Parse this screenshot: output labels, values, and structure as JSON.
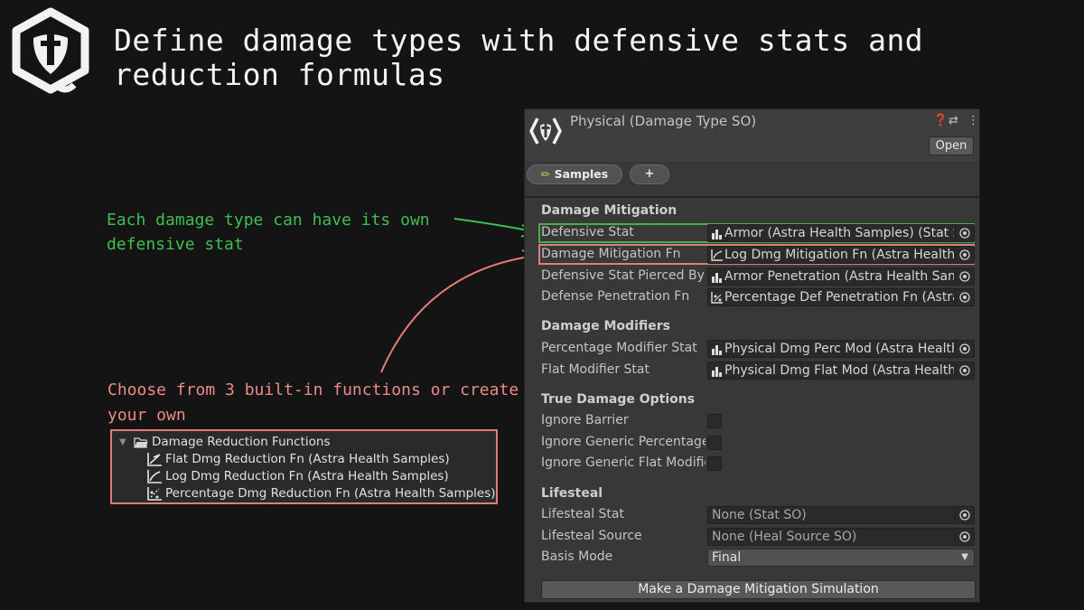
{
  "headline": "Define damage types with defensive stats and reduction formulas",
  "annotations": {
    "green": "Each damage type can have its own defensive stat",
    "red": "Choose from 3 built-in functions or create your own"
  },
  "tree": {
    "folder": "Damage Reduction Functions",
    "items": [
      "Flat Dmg Reduction Fn (Astra Health Samples)",
      "Log Dmg Reduction Fn (Astra Health Samples)",
      "Percentage Dmg Reduction  Fn (Astra Health Samples)"
    ]
  },
  "inspector": {
    "title": "Physical (Damage Type SO)",
    "open_label": "Open",
    "tab_samples": "Samples",
    "tab_add": "+",
    "sections": {
      "mitigation": "Damage Mitigation",
      "modifiers": "Damage Modifiers",
      "true_damage": "True Damage Options",
      "lifesteal": "Lifesteal"
    },
    "fields": {
      "defensive_stat": {
        "label": "Defensive Stat",
        "value": "Armor (Astra Health Samples) (Stat SO)"
      },
      "mitigation_fn": {
        "label": "Damage Mitigation Fn",
        "value": "Log Dmg Mitigation Fn (Astra Health Samples)"
      },
      "pierced_by": {
        "label": "Defensive Stat Pierced By",
        "value": "Armor Penetration (Astra Health Samples)"
      },
      "penetration_fn": {
        "label": "Defense Penetration Fn",
        "value": "Percentage Def Penetration Fn (Astra Health Samples)"
      },
      "perc_modifier": {
        "label": "Percentage Modifier Stat",
        "value": "Physical Dmg Perc Mod (Astra Health Samples)"
      },
      "flat_modifier": {
        "label": "Flat Modifier Stat",
        "value": "Physical Dmg Flat Mod (Astra Health Samples)"
      },
      "ignore_barrier": {
        "label": "Ignore Barrier"
      },
      "ignore_generic_perc": {
        "label": "Ignore Generic Percentage"
      },
      "ignore_generic_flat": {
        "label": "Ignore Generic Flat Modifier"
      },
      "lifesteal_stat": {
        "label": "Lifesteal Stat",
        "value": "None (Stat SO)"
      },
      "lifesteal_source": {
        "label": "Lifesteal Source",
        "value": "None (Heal Source SO)"
      },
      "basis_mode": {
        "label": "Basis Mode",
        "value": "Final"
      }
    },
    "simulate_label": "Make a Damage Mitigation Simulation"
  },
  "colors": {
    "green_accent": "#3fbf52",
    "red_accent": "#ec8b87",
    "background": "#141414",
    "inspector_bg": "#383838"
  }
}
